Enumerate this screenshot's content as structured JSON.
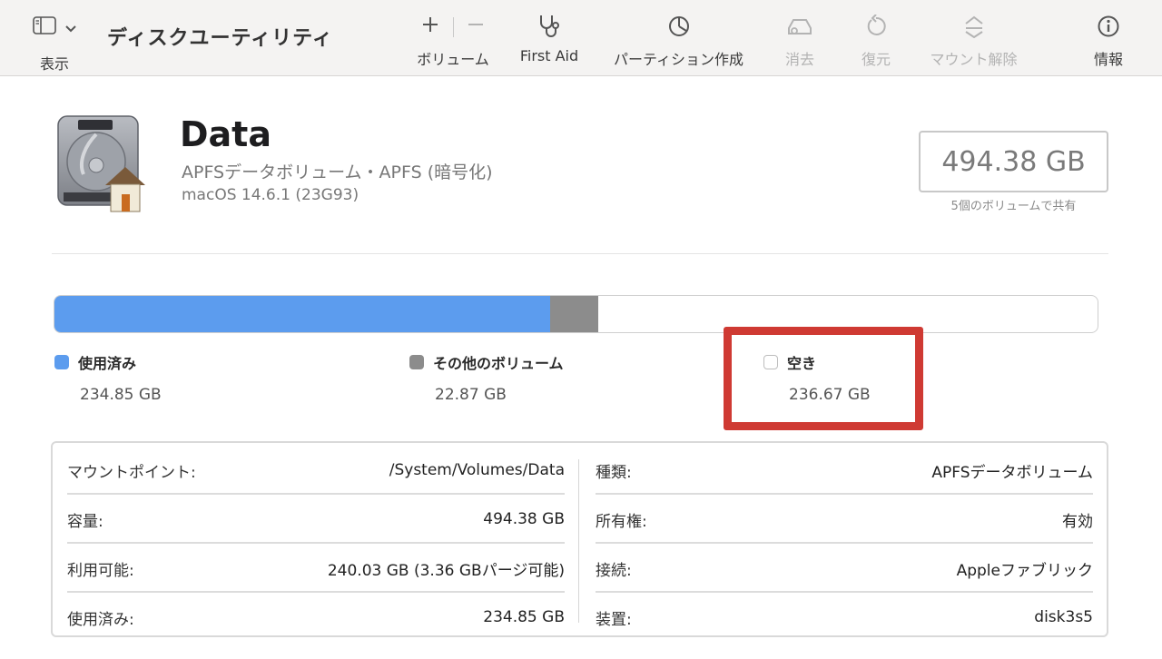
{
  "toolbar": {
    "view_label": "表示",
    "title": "ディスクユーティリティ",
    "volume_label": "ボリューム",
    "first_aid_label": "First Aid",
    "partition_label": "パーティション作成",
    "erase_label": "消去",
    "restore_label": "復元",
    "unmount_label": "マウント解除",
    "info_label": "情報"
  },
  "volume": {
    "name": "Data",
    "subtitle": "APFSデータボリューム・APFS (暗号化)",
    "os": "macOS 14.6.1 (23G93)",
    "capacity": "494.38 GB",
    "shared_note": "5個のボリュームで共有"
  },
  "usage": {
    "used_fraction": 0.4751,
    "other_fraction": 0.0463,
    "colors": {
      "used": "#5c9cee",
      "other": "#8c8c8c",
      "free": "#ffffff",
      "highlight": "#cf3a33"
    },
    "legend": [
      {
        "name": "使用済み",
        "value": "234.85 GB"
      },
      {
        "name": "その他のボリューム",
        "value": "22.87 GB"
      },
      {
        "name": "空き",
        "value": "236.67 GB"
      }
    ]
  },
  "info": {
    "left": [
      {
        "key": "マウントポイント:",
        "value": "/System/Volumes/Data"
      },
      {
        "key": "容量:",
        "value": "494.38 GB"
      },
      {
        "key": "利用可能:",
        "value": "240.03 GB (3.36 GBパージ可能)"
      },
      {
        "key": "使用済み:",
        "value": "234.85 GB"
      }
    ],
    "right": [
      {
        "key": "種類:",
        "value": "APFSデータボリューム"
      },
      {
        "key": "所有権:",
        "value": "有効"
      },
      {
        "key": "接続:",
        "value": "Appleファブリック"
      },
      {
        "key": "装置:",
        "value": "disk3s5"
      }
    ]
  }
}
